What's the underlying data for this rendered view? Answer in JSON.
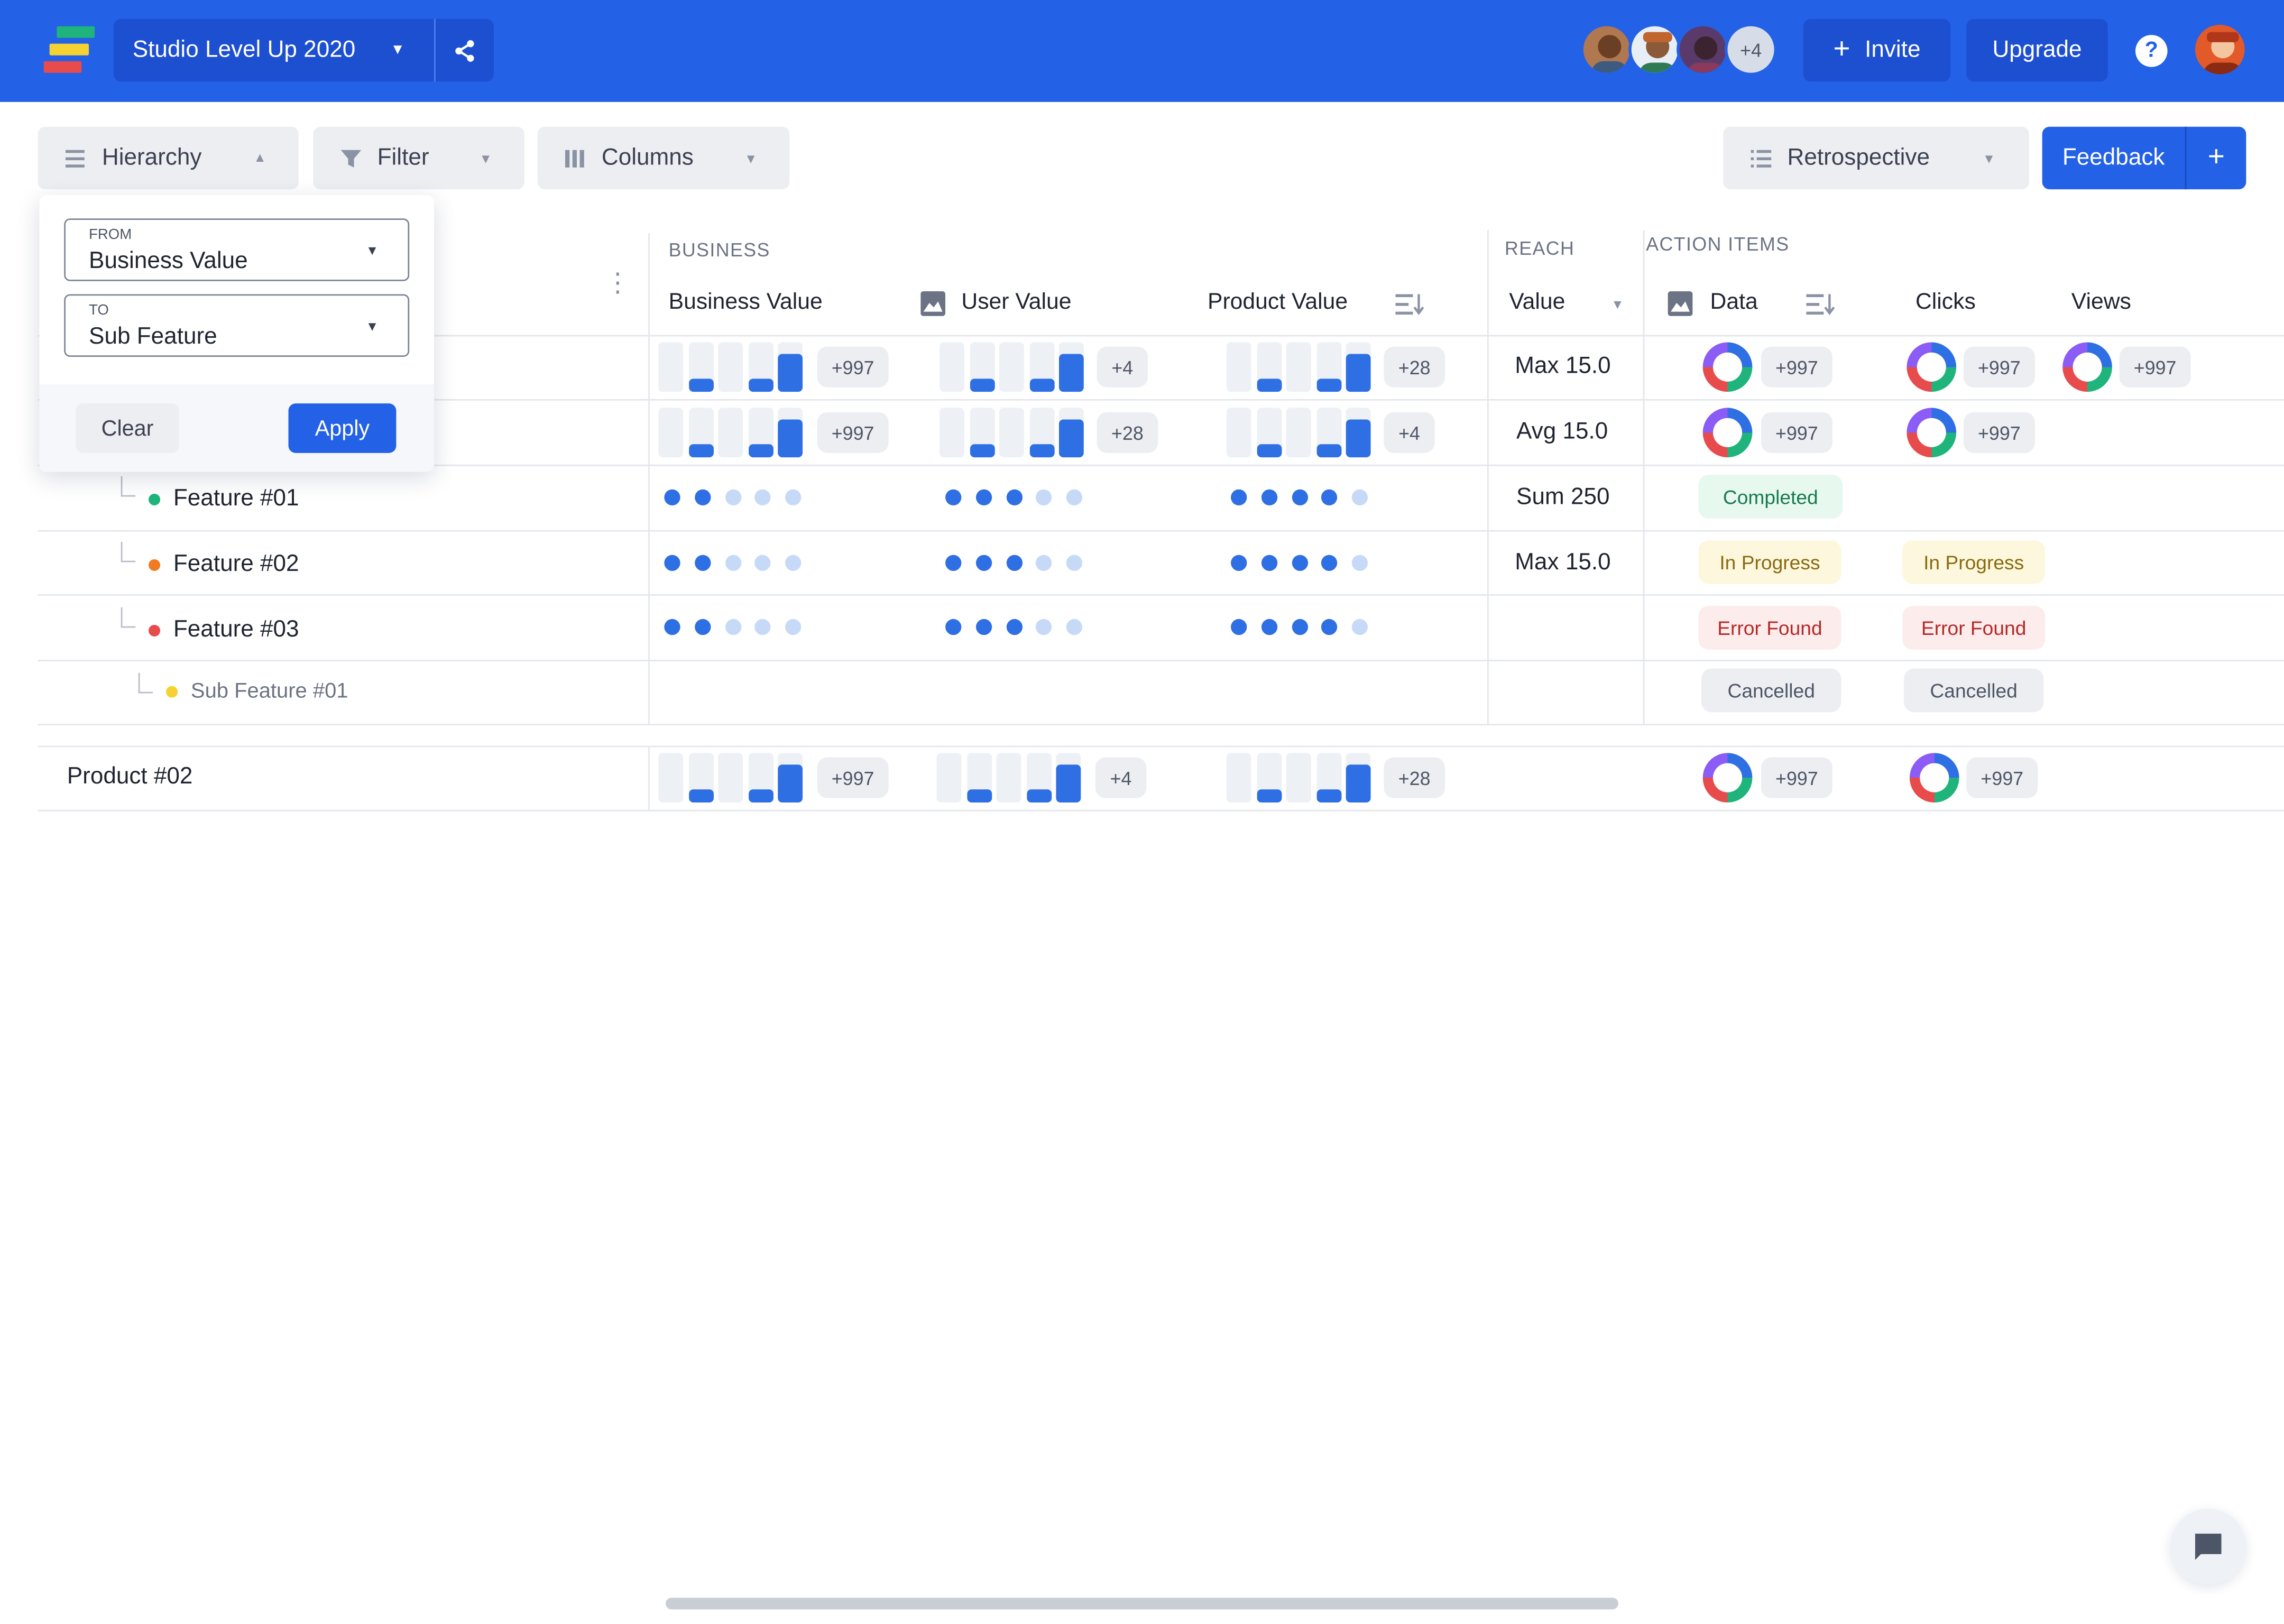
{
  "topbar": {
    "project_name": "Studio Level Up 2020",
    "avatars_more": "+4",
    "invite_label": "Invite",
    "upgrade_label": "Upgrade",
    "help_glyph": "?",
    "brand_color": "#2361e6"
  },
  "toolbar": {
    "hierarchy_label": "Hierarchy",
    "filter_label": "Filter",
    "columns_label": "Columns",
    "view_label": "Retrospective",
    "feedback_label": "Feedback",
    "add_glyph": "+"
  },
  "hierarchy_popover": {
    "from_label": "FROM",
    "from_value": "Business Value",
    "to_label": "TO",
    "to_value": "Sub Feature",
    "clear_label": "Clear",
    "apply_label": "Apply"
  },
  "table": {
    "groups": {
      "business": "BUSINESS",
      "reach": "REACH",
      "action_items": "ACTION ITEMS"
    },
    "columns": {
      "business_value": "Business Value",
      "user_value": "User Value",
      "product_value": "Product Value",
      "value": "Value",
      "data": "Data",
      "clicks": "Clicks",
      "views": "Views"
    },
    "rows": [
      {
        "bv_badge": "+997",
        "uv_badge": "+4",
        "pv_badge": "+28",
        "reach": "Max 15.0",
        "data_badge": "+997",
        "clicks_badge": "+997",
        "views_badge": "+997"
      },
      {
        "bv_badge": "+997",
        "uv_badge": "+28",
        "pv_badge": "+4",
        "reach": "Avg 15.0",
        "data_badge": "+997",
        "clicks_badge": "+997"
      },
      {
        "label": "Feature #01",
        "bullet_color": "#1fb47c",
        "bv_dots": 2,
        "uv_dots": 3,
        "pv_dots": 4,
        "reach": "Sum 250",
        "data_status": "Completed"
      },
      {
        "label": "Feature #02",
        "bullet_color": "#f07b22",
        "bv_dots": 2,
        "uv_dots": 3,
        "pv_dots": 4,
        "reach": "Max 15.0",
        "data_status": "In Progress",
        "clicks_status": "In Progress"
      },
      {
        "label": "Feature #03",
        "bullet_color": "#e84b4b",
        "bv_dots": 2,
        "uv_dots": 3,
        "pv_dots": 4,
        "data_status": "Error Found",
        "clicks_status": "Error Found"
      },
      {
        "label": "Sub Feature #01",
        "bullet_color": "#f5d232",
        "data_status": "Cancelled",
        "clicks_status": "Cancelled"
      }
    ],
    "product2": {
      "label": "Product #02",
      "bv_badge": "+997",
      "uv_badge": "+4",
      "pv_badge": "+28",
      "data_badge": "+997",
      "clicks_badge": "+997"
    }
  },
  "icons": {
    "logo": "logo-icon",
    "share": "share-icon",
    "hierarchy": "list-icon",
    "filter": "filter-icon",
    "columns": "columns-icon",
    "image": "image-icon",
    "sort": "sort-icon",
    "chat": "chat-icon"
  }
}
